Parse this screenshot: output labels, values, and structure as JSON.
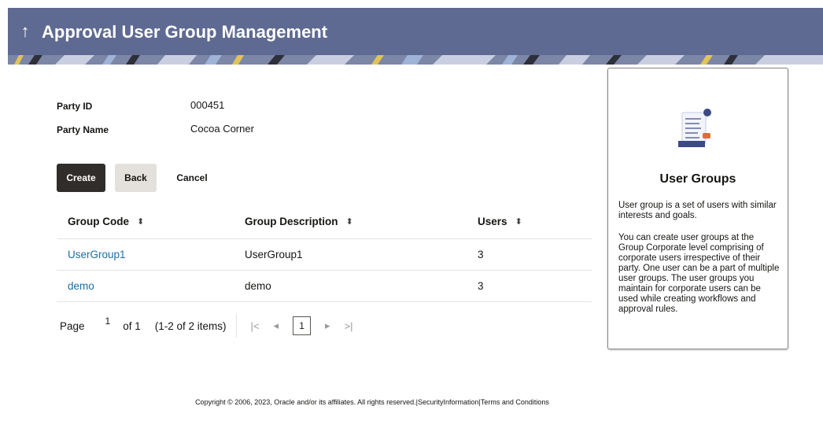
{
  "header": {
    "title": "Approval User Group Management",
    "back_icon": "↑"
  },
  "party": {
    "id_label": "Party ID",
    "id_value": "000451",
    "name_label": "Party Name",
    "name_value": "Cocoa Corner"
  },
  "actions": {
    "create": "Create",
    "back": "Back",
    "cancel": "Cancel"
  },
  "table": {
    "columns": [
      "Group Code",
      "Group Description",
      "Users"
    ],
    "rows": [
      {
        "code": "UserGroup1",
        "description": "UserGroup1",
        "users": "3"
      },
      {
        "code": "demo",
        "description": "demo",
        "users": "3"
      }
    ]
  },
  "pagination": {
    "page_label": "Page",
    "current_page": "1",
    "of_label": "of 1",
    "range": "(1-2 of 2 items)",
    "page_button": "1",
    "first_icon": "|<",
    "prev_icon": "◂",
    "next_icon": "▸",
    "last_icon": ">|"
  },
  "help_panel": {
    "title": "User Groups",
    "paragraph1": "User group is a set of users with similar interests and goals.",
    "paragraph2": "You can create user groups at the Group Corporate level comprising of corporate users irrespective of their party. One user can be a part of multiple user groups. The user groups you maintain for corporate users can be used while creating workflows and approval rules."
  },
  "footer": {
    "text": "Copyright © 2006, 2023, Oracle and/or its affiliates. All rights reserved.|SecurityInformation|Terms and Conditions"
  },
  "colors": {
    "header_bg": "#5f6a92",
    "primary_button": "#312d2a",
    "secondary_button": "#e4e1dd",
    "link": "#1a6fa2"
  }
}
